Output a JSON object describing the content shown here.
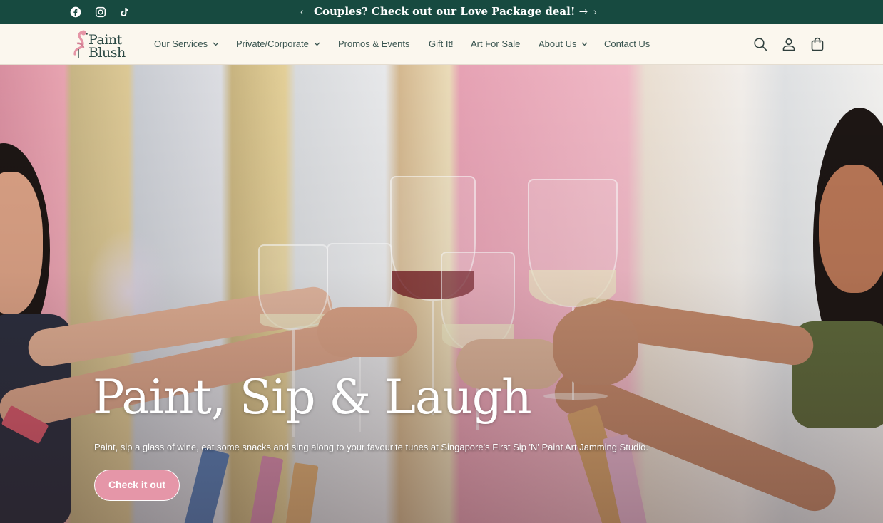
{
  "announcement": {
    "text": "Couples? Check out our Love Package deal! →",
    "prev_arrow": "‹",
    "next_arrow": "›",
    "social_icons": [
      "facebook-icon",
      "instagram-icon",
      "tiktok-icon"
    ],
    "background": "#174a40"
  },
  "header": {
    "logo_line1": "Paint",
    "logo_line2": "Blush",
    "nav": [
      {
        "label": "Our Services",
        "has_dropdown": true
      },
      {
        "label": "Private/Corporate",
        "has_dropdown": true
      },
      {
        "label": "Promos & Events",
        "has_dropdown": false
      },
      {
        "label": "Gift It!",
        "has_dropdown": false
      },
      {
        "label": "Art For Sale",
        "has_dropdown": false
      },
      {
        "label": "About Us",
        "has_dropdown": true
      },
      {
        "label": "Contact Us",
        "has_dropdown": false
      }
    ],
    "icons": [
      "search-icon",
      "account-icon",
      "cart-icon"
    ]
  },
  "hero": {
    "title": "Paint, Sip & Laugh",
    "subtitle": "Paint, sip a glass of wine, eat some snacks and sing along to your favourite tunes at Singapore's First Sip 'N' Paint Art Jamming Studio.",
    "button_label": "Check it out",
    "button_color": "#e596a8"
  }
}
